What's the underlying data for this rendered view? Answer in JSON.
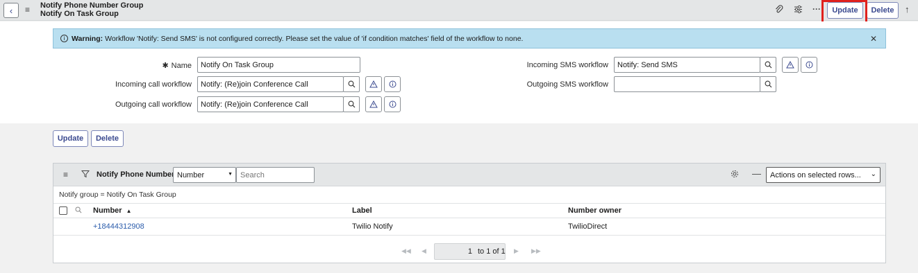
{
  "header": {
    "title_line1": "Notify Phone Number Group",
    "title_line2": "Notify On Task Group",
    "update_label": "Update",
    "delete_label": "Delete"
  },
  "warning": {
    "prefix": "Warning:",
    "text": "Workflow 'Notify: Send SMS' is not configured correctly. Please set the value of 'if condition matches' field of the workflow to none."
  },
  "form": {
    "name_label": "Name",
    "name_value": "Notify On Task Group",
    "incoming_call_label": "Incoming call workflow",
    "incoming_call_value": "Notify: (Re)join Conference Call",
    "outgoing_call_label": "Outgoing call workflow",
    "outgoing_call_value": "Notify: (Re)join Conference Call",
    "incoming_sms_label": "Incoming SMS workflow",
    "incoming_sms_value": "Notify: Send SMS",
    "outgoing_sms_label": "Outgoing SMS workflow",
    "outgoing_sms_value": ""
  },
  "actions": {
    "update_label": "Update",
    "delete_label": "Delete"
  },
  "related_list": {
    "title": "Notify Phone Numbers",
    "search_field": "Number",
    "search_placeholder": "Search",
    "actions_select": "Actions on selected rows...",
    "filter_text": "Notify group = Notify On Task Group",
    "columns": [
      "Number",
      "Label",
      "Number owner"
    ],
    "rows": [
      {
        "number": "+18444312908",
        "label": "Twilio Notify",
        "owner": "TwilioDirect"
      }
    ],
    "pager": {
      "current": "1",
      "text": "to 1 of 1"
    }
  },
  "colors": {
    "accent": "#3b4a8f",
    "highlight_box": "#e0211d",
    "warning_bg": "#b9dff0",
    "link": "#2b5cab"
  }
}
